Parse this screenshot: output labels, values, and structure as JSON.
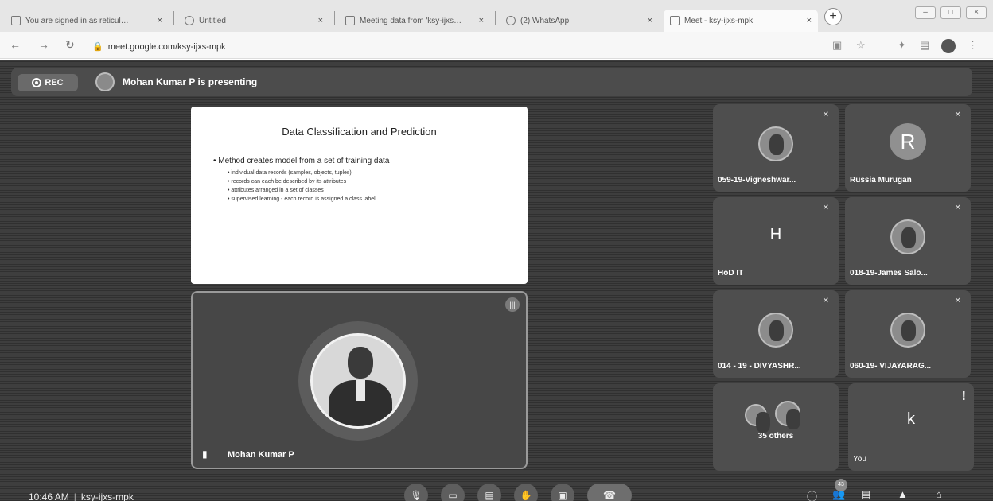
{
  "browser": {
    "tabs": [
      {
        "title": "You are signed in as reticulation",
        "active": false
      },
      {
        "title": "Untitled",
        "active": false
      },
      {
        "title": "Meeting data from 'ksy-ijxs-mpk'",
        "active": false
      },
      {
        "title": "(2) WhatsApp",
        "active": false
      },
      {
        "title": "Meet - ksy-ijxs-mpk",
        "active": true
      }
    ],
    "url": "meet.google.com/ksy-ijxs-mpk",
    "new_tab_symbol": "+"
  },
  "meet": {
    "rec_label": "REC",
    "presenting_text": "Mohan Kumar P is presenting",
    "slide": {
      "title": "Data Classification and Prediction",
      "bullet": "Method creates model from a set of training data",
      "sub_bullets": [
        "individual data records (samples, objects, tuples)",
        "records can each be described by its attributes",
        "attributes arranged in a set of classes",
        "supervised learning - each record is assigned a class label"
      ]
    },
    "presenter": {
      "name": "Mohan Kumar P"
    },
    "participants": [
      {
        "name": "059-19-Vigneshwar...",
        "kind": "photo",
        "initial": ""
      },
      {
        "name": "Russia Murugan",
        "kind": "initial-circle",
        "initial": "R"
      },
      {
        "name": "HoD IT",
        "kind": "initial",
        "initial": "H"
      },
      {
        "name": "018-19-James Salo...",
        "kind": "photo",
        "initial": ""
      },
      {
        "name": "014 - 19 - DIVYASHR...",
        "kind": "photo",
        "initial": ""
      },
      {
        "name": "060-19- VIJAYARAG...",
        "kind": "photo",
        "initial": ""
      },
      {
        "name": "35 others",
        "kind": "group",
        "initial": ""
      },
      {
        "name": "You",
        "kind": "initial",
        "initial": "k"
      }
    ],
    "clock": "10:46 AM",
    "meeting_code": "ksy-ijxs-mpk",
    "people_count": "43"
  },
  "colors": {
    "meet_background": "#3a3a3a",
    "tile_background": "#4e4e4e",
    "slide_background": "#ffffff"
  }
}
